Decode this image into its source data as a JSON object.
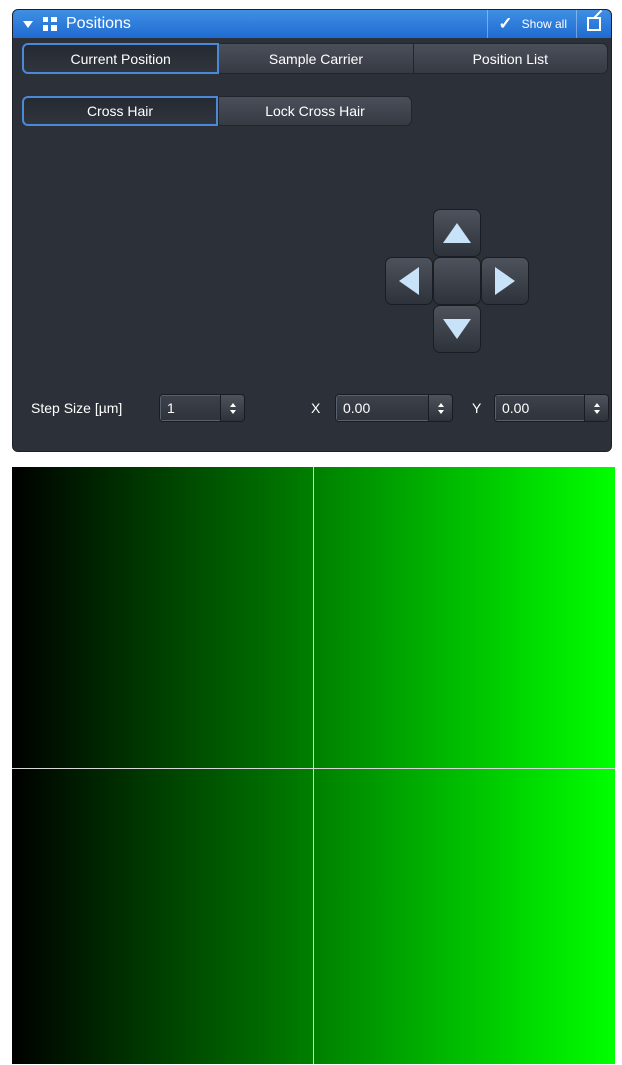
{
  "panel": {
    "title": "Positions",
    "show_all_label": "Show all",
    "accent_color": "#2f7ddc",
    "icons": [
      "collapse-triangle-icon",
      "positions-grid-icon",
      "checkmark-icon",
      "undock-icon"
    ]
  },
  "tabs": [
    {
      "label": "Current Position",
      "active": true
    },
    {
      "label": "Sample Carrier",
      "active": false
    },
    {
      "label": "Position List",
      "active": false
    }
  ],
  "crosshair_buttons": [
    {
      "label": "Cross Hair",
      "active": true
    },
    {
      "label": "Lock Cross Hair",
      "active": false
    }
  ],
  "stage_controls": {
    "icons": [
      "arrow-up-icon",
      "arrow-left-icon",
      "center-button",
      "arrow-right-icon",
      "arrow-down-icon"
    ]
  },
  "inputs": {
    "step_size": {
      "label": "Step Size [µm]",
      "value": "1"
    },
    "x": {
      "label": "X",
      "value": "0.00"
    },
    "y": {
      "label": "Y",
      "value": "0.00"
    }
  },
  "image_view": {
    "gradient_from": "#000000",
    "gradient_to": "#00ff00",
    "crosshair_color": "#d8d8d8"
  }
}
